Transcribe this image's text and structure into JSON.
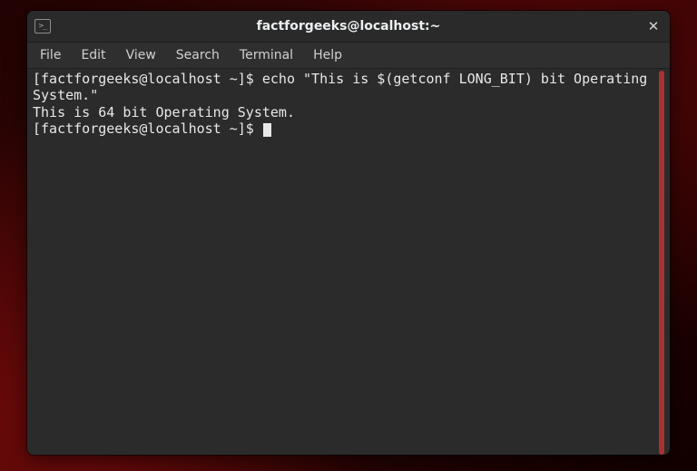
{
  "window": {
    "title": "factforgeeks@localhost:~"
  },
  "menubar": {
    "items": [
      "File",
      "Edit",
      "View",
      "Search",
      "Terminal",
      "Help"
    ]
  },
  "terminal": {
    "prompt": "[factforgeeks@localhost ~]$ ",
    "command": "echo \"This is $(getconf LONG_BIT) bit Operating System.\"",
    "output": "This is 64 bit Operating System.",
    "prompt2": "[factforgeeks@localhost ~]$ "
  }
}
